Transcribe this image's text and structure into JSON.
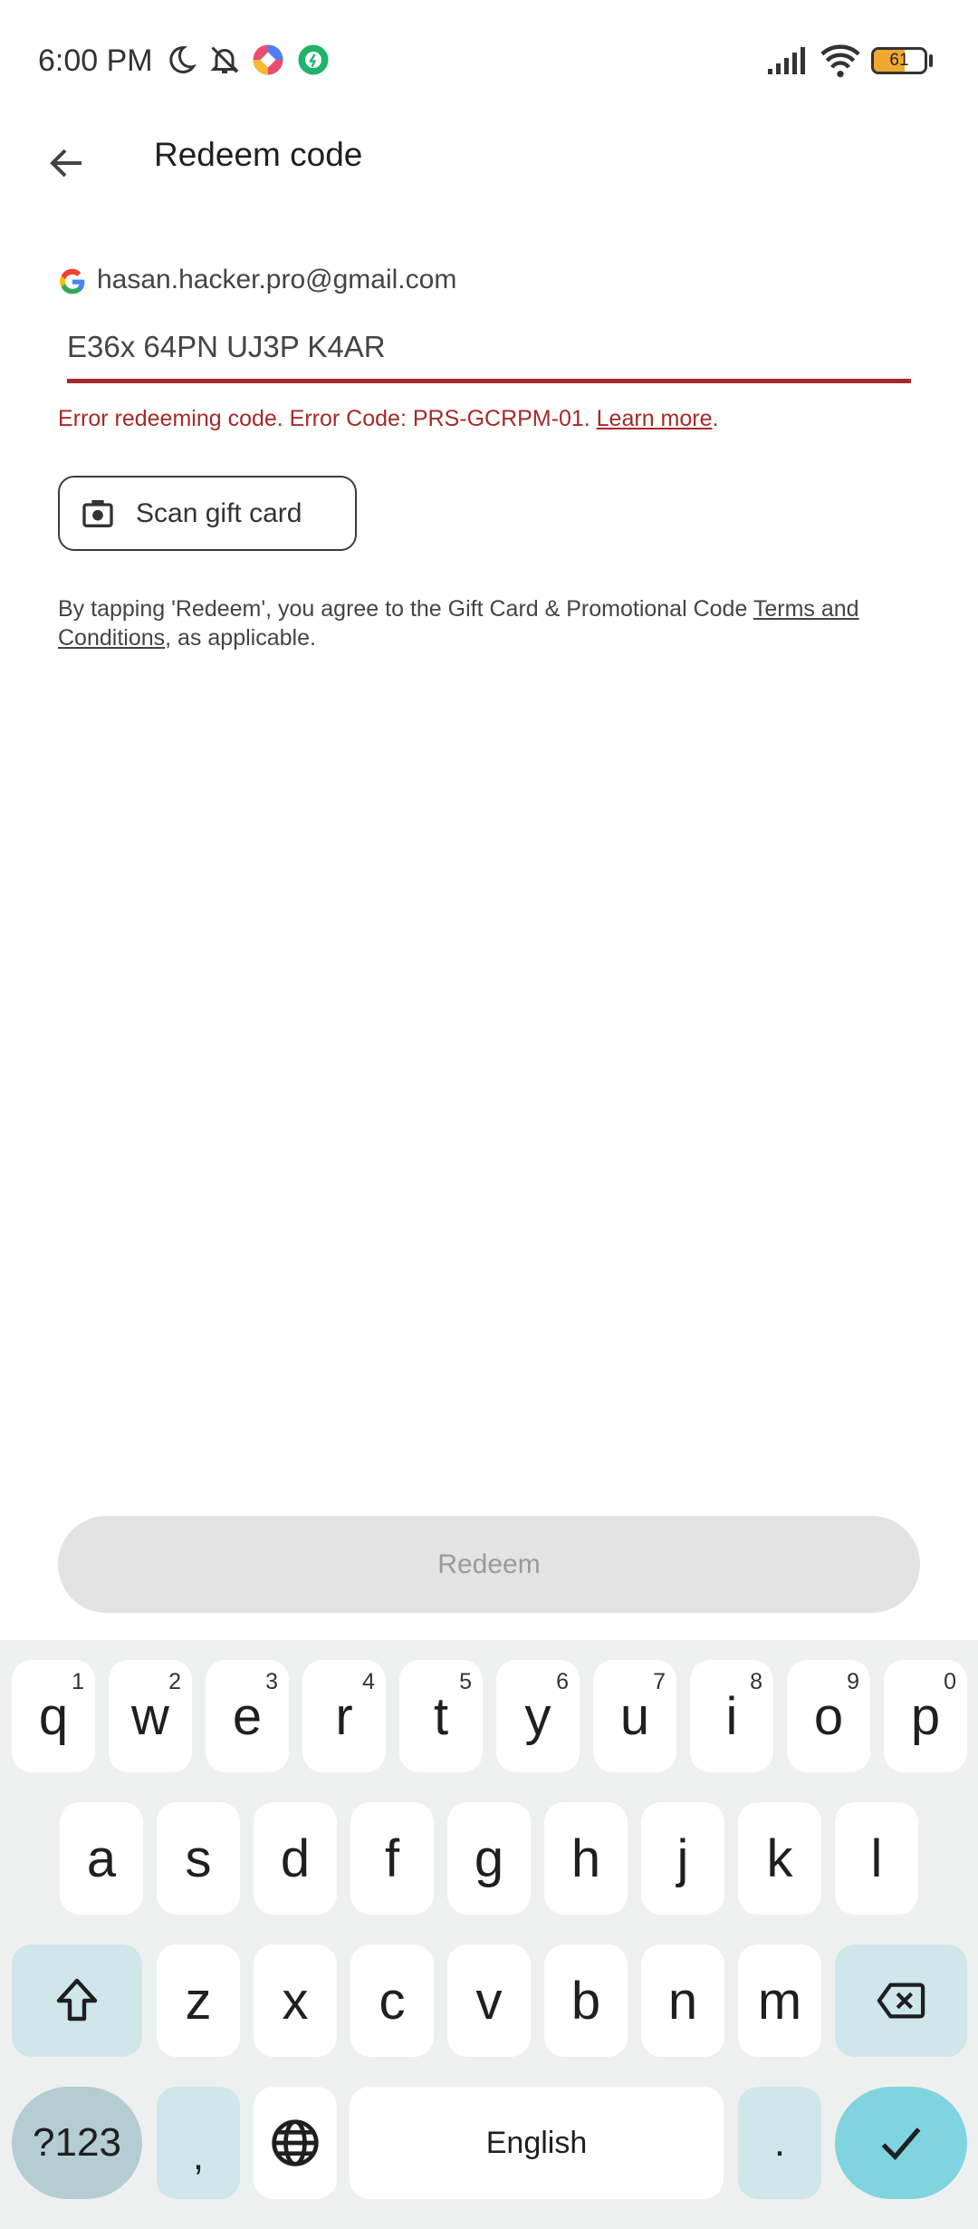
{
  "status_bar": {
    "time": "6:00 PM",
    "battery": "61",
    "icons": [
      "moon-icon",
      "bell-off-icon",
      "app-icon",
      "green-app-icon",
      "signal-icon",
      "wifi-icon",
      "battery-icon"
    ]
  },
  "header": {
    "title": "Redeem code",
    "back_icon": "arrow-left-icon"
  },
  "account": {
    "email": "hasan.hacker.pro@gmail.com"
  },
  "code_input": {
    "value": "E36x 64PN UJ3P K4AR"
  },
  "error": {
    "text": "Error redeeming code. Error Code: PRS-GCRPM-01. ",
    "link": "Learn more",
    "end": ".",
    "color": "#a52a2a"
  },
  "scan_button": {
    "label": "Scan gift card"
  },
  "terms": {
    "prefix": "By tapping 'Redeem', you agree to the Gift Card & Promotional Code ",
    "link": "Terms and Conditions",
    "suffix": ", as applicable."
  },
  "redeem_button": {
    "label": "Redeem"
  },
  "keyboard": {
    "row1": [
      [
        "q",
        "1"
      ],
      [
        "w",
        "2"
      ],
      [
        "e",
        "3"
      ],
      [
        "r",
        "4"
      ],
      [
        "t",
        "5"
      ],
      [
        "y",
        "6"
      ],
      [
        "u",
        "7"
      ],
      [
        "i",
        "8"
      ],
      [
        "o",
        "9"
      ],
      [
        "p",
        "0"
      ]
    ],
    "row2": [
      "a",
      "s",
      "d",
      "f",
      "g",
      "h",
      "j",
      "k",
      "l"
    ],
    "row3": [
      "z",
      "x",
      "c",
      "v",
      "b",
      "n",
      "m"
    ],
    "symbols": "?123",
    "comma": ",",
    "period": ".",
    "space": "English",
    "colors": {
      "background": "#eef0f0",
      "modifier": "#cfe6eb",
      "symbols": "#b3cdd2",
      "enter": "#80d4df"
    }
  }
}
